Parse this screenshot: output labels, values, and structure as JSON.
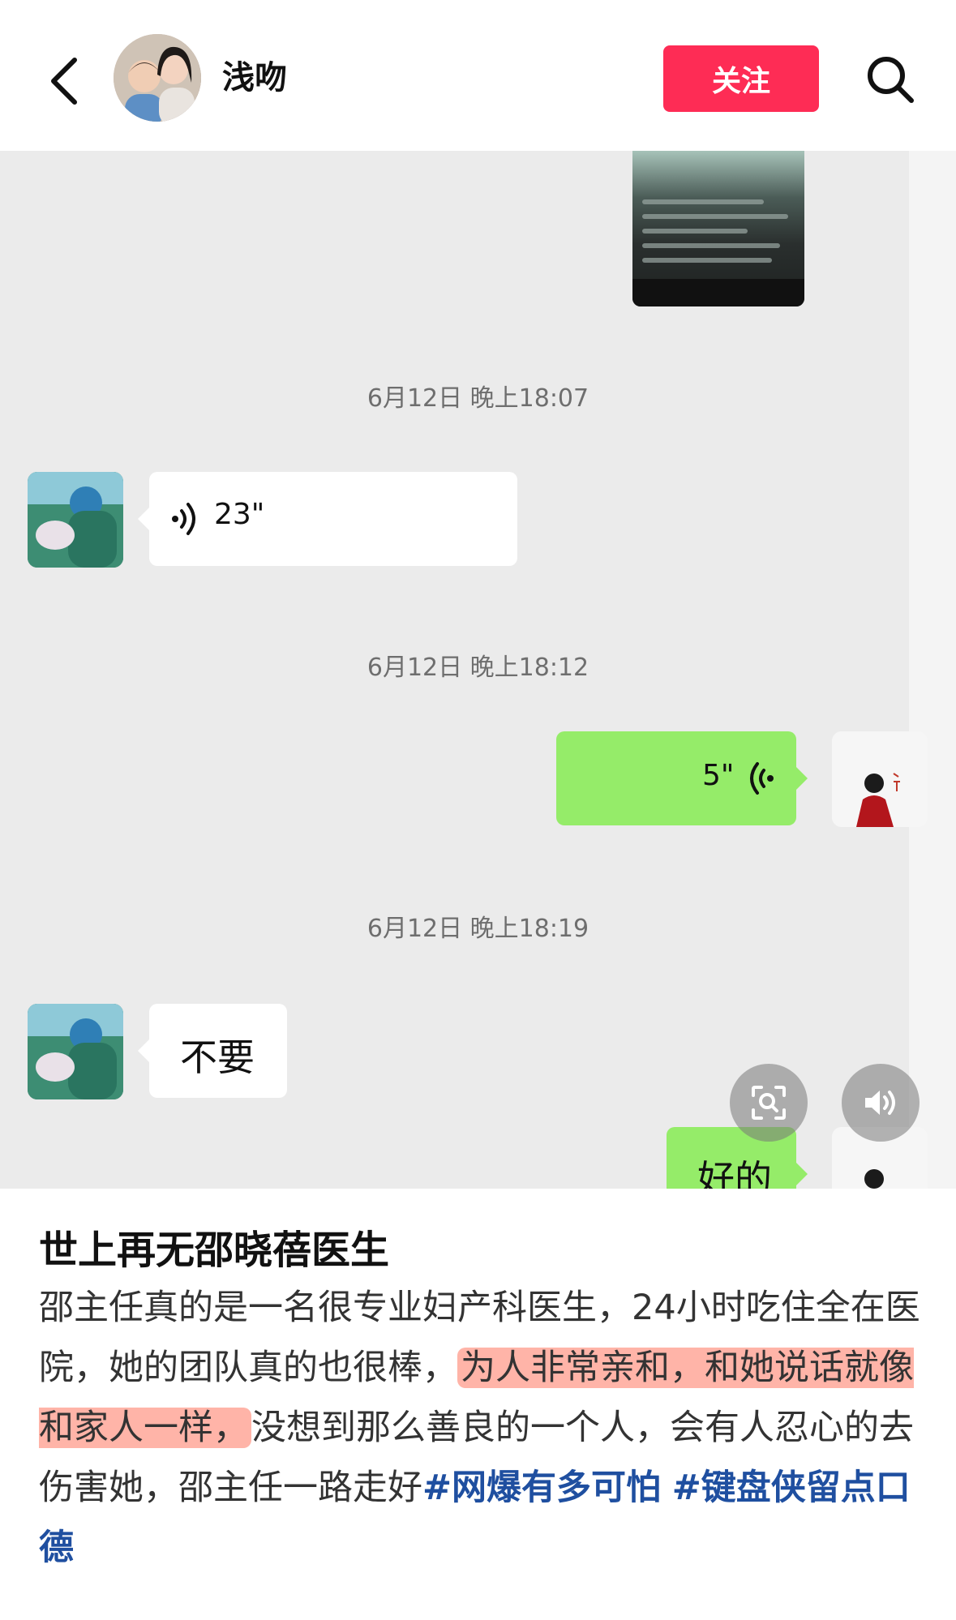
{
  "header": {
    "name": "浅吻",
    "follow_label": "关注",
    "icons": [
      "back-chevron-icon",
      "search-icon"
    ]
  },
  "chat": {
    "timestamps": [
      "6月12日 晚上18:07",
      "6月12日 晚上18:12",
      "6月12日 晚上18:19"
    ],
    "messages": [
      {
        "sender": "peer",
        "type": "voice",
        "duration": "23\""
      },
      {
        "sender": "self",
        "type": "voice",
        "duration": "5\""
      },
      {
        "sender": "peer",
        "type": "text",
        "text": "不要"
      },
      {
        "sender": "self",
        "type": "text",
        "text": "好的"
      }
    ],
    "colors": {
      "self_bubble": "#95ec69",
      "peer_bubble": "#ffffff",
      "background": "#ebebeb"
    },
    "float_icons": [
      "image-search-icon",
      "volume-icon"
    ]
  },
  "post": {
    "title": "世上再无邵晓蓓医生",
    "body_before": "邵主任真的是一名很专业妇产科医生，24小时吃住全在医院，她的团队真的也很棒，",
    "highlight": "为人非常亲和，和她说话就像和家人一样，",
    "body_after": "没想到那么善良的一个人，会有人忍心的去伤害她，邵主任一路走好",
    "hashtags": [
      "#网爆有多可怕",
      "#键盘侠留点口德"
    ],
    "colors": {
      "highlight": "#ffb4a8",
      "hashtag": "#1f4fa0",
      "follow": "#fe2c55"
    }
  }
}
